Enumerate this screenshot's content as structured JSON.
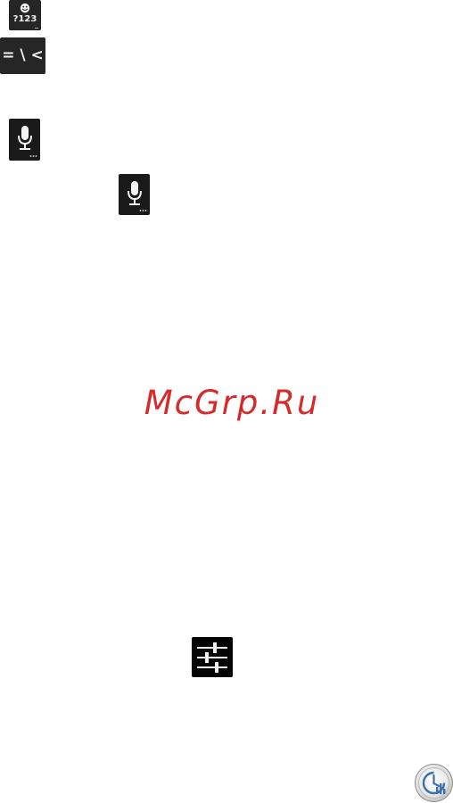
{
  "keys": {
    "symbols": {
      "label": "?123",
      "icon": "emoticon-icon"
    },
    "special_chars": {
      "label": "= \\ <"
    },
    "voice_input_1": {
      "icon": "microphone-icon"
    },
    "voice_input_2": {
      "icon": "microphone-icon"
    },
    "settings": {
      "icon": "sliders-icon"
    }
  },
  "watermark": {
    "text": "McGrp.Ru",
    "color": "#d42b2b"
  },
  "round_button": {
    "icon": "clock-chart-icon"
  },
  "colors": {
    "key_background": "#1a1a1a",
    "key_text": "#f0f0f0"
  }
}
